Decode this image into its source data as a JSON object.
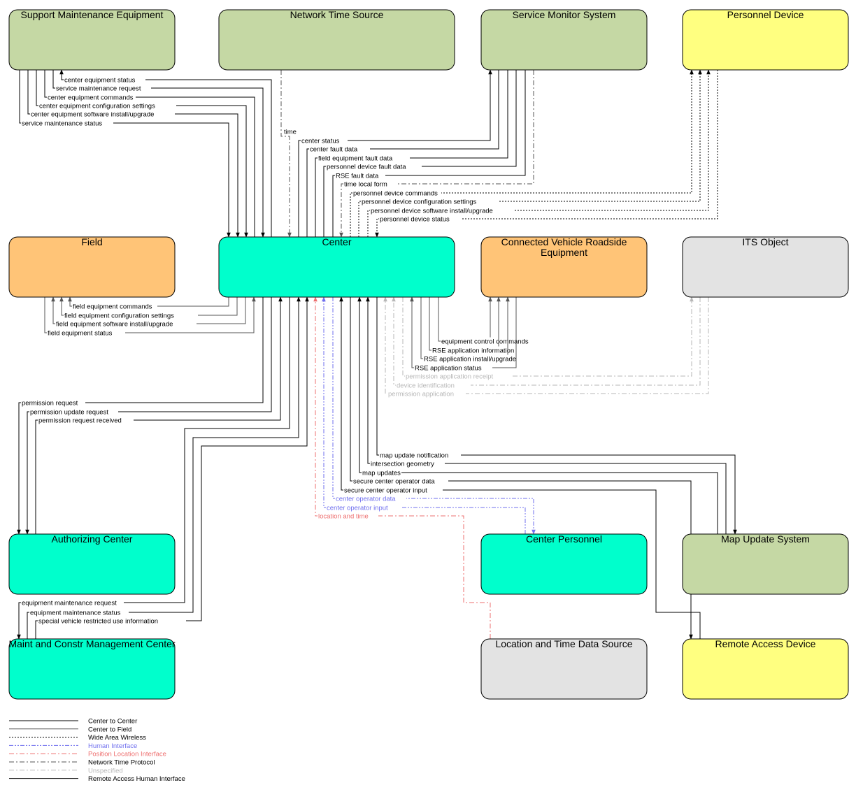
{
  "colors": {
    "center": "#00ffcc",
    "field": "#ffc477",
    "system": "#c5d8a4",
    "device": "#ffff80",
    "other": "#e3e3e3",
    "center_to_center": "#000000",
    "center_to_field": "#555555",
    "wide_area_wireless": "#000000",
    "human_interface": "#6f6fee",
    "position_location": "#ee6f6f",
    "network_time": "#555555",
    "unspecified": "#b7b7b7",
    "remote_access": "#000000"
  },
  "nodes": {
    "support_maintenance_equipment": {
      "title": "Support Maintenance Equipment",
      "color": "system"
    },
    "network_time_source": {
      "title": "Network Time Source",
      "color": "system"
    },
    "service_monitor_system": {
      "title": "Service Monitor System",
      "color": "system"
    },
    "personnel_device": {
      "title": "Personnel Device",
      "color": "device"
    },
    "field": {
      "title": "Field",
      "color": "field"
    },
    "center": {
      "title": "Center",
      "color": "center"
    },
    "connected_vehicle_roadside_equipment": {
      "title_lines": [
        "Connected Vehicle Roadside",
        "Equipment"
      ],
      "color": "field"
    },
    "its_object": {
      "title": "ITS Object",
      "color": "other"
    },
    "authorizing_center": {
      "title": "Authorizing Center",
      "color": "center"
    },
    "center_personnel": {
      "title": "Center Personnel",
      "color": "center"
    },
    "map_update_system": {
      "title": "Map Update System",
      "color": "system"
    },
    "maint_and_constr_management_center": {
      "title": "Maint and Constr Management Center",
      "color": "center"
    },
    "location_and_time_data_source": {
      "title": "Location and Time Data Source",
      "color": "other"
    },
    "remote_access_device": {
      "title": "Remote Access Device",
      "color": "device"
    }
  },
  "flows": {
    "center_equipment_status": "center equipment status",
    "service_maintenance_request": "service maintenance request",
    "center_equipment_commands": "center equipment commands",
    "center_equipment_configuration_settings": "center equipment configuration settings",
    "center_equipment_software_install_upgrade": "center equipment software install/upgrade",
    "service_maintenance_status": "service maintenance status",
    "time": "time",
    "center_status": "center status",
    "center_fault_data": "center fault data",
    "field_equipment_fault_data": "field equipment fault data",
    "personnel_device_fault_data": "personnel device fault data",
    "rse_fault_data": "RSE fault data",
    "time_local_form": "time local form",
    "personnel_device_commands": "personnel device commands",
    "personnel_device_configuration_settings": "personnel device configuration settings",
    "personnel_device_software_install_upgrade": "personnel device software install/upgrade",
    "personnel_device_status": "personnel device status",
    "field_equipment_commands": "field equipment commands",
    "field_equipment_configuration_settings": "field equipment configuration settings",
    "field_equipment_software_install_upgrade": "field equipment software install/upgrade",
    "field_equipment_status": "field equipment status",
    "equipment_control_commands": "equipment control commands",
    "rse_application_information": "RSE application information",
    "rse_application_install_upgrade": "RSE application install/upgrade",
    "rse_application_status": "RSE application status",
    "permission_application_receipt": "permission application receipt",
    "device_identification": "device identification",
    "permission_application": "permission application",
    "permission_request": "permission request",
    "permission_update_request": "permission update request",
    "permission_request_received": "permission request received",
    "map_update_notification": "map update notification",
    "intersection_geometry": "intersection geometry",
    "map_updates": "map updates",
    "secure_center_operator_data": "secure center operator data",
    "secure_center_operator_input": "secure center operator input",
    "center_operator_data": "center operator data",
    "center_operator_input": "center operator input",
    "location_and_time": "location and time",
    "equipment_maintenance_request": "equipment maintenance request",
    "equipment_maintenance_status": "equipment maintenance status",
    "special_vehicle_restricted_use_information": "special vehicle restricted use information"
  },
  "legend": [
    {
      "label": "Center to Center",
      "style": "center_to_center"
    },
    {
      "label": "Center to Field",
      "style": "center_to_field"
    },
    {
      "label": "Wide Area Wireless",
      "style": "wide_area_wireless"
    },
    {
      "label": "Human Interface",
      "style": "human_interface"
    },
    {
      "label": "Position Location Interface",
      "style": "position_location"
    },
    {
      "label": "Network Time Protocol",
      "style": "network_time"
    },
    {
      "label": "Unspecified",
      "style": "unspecified"
    },
    {
      "label": "Remote Access Human Interface",
      "style": "remote_access"
    }
  ]
}
